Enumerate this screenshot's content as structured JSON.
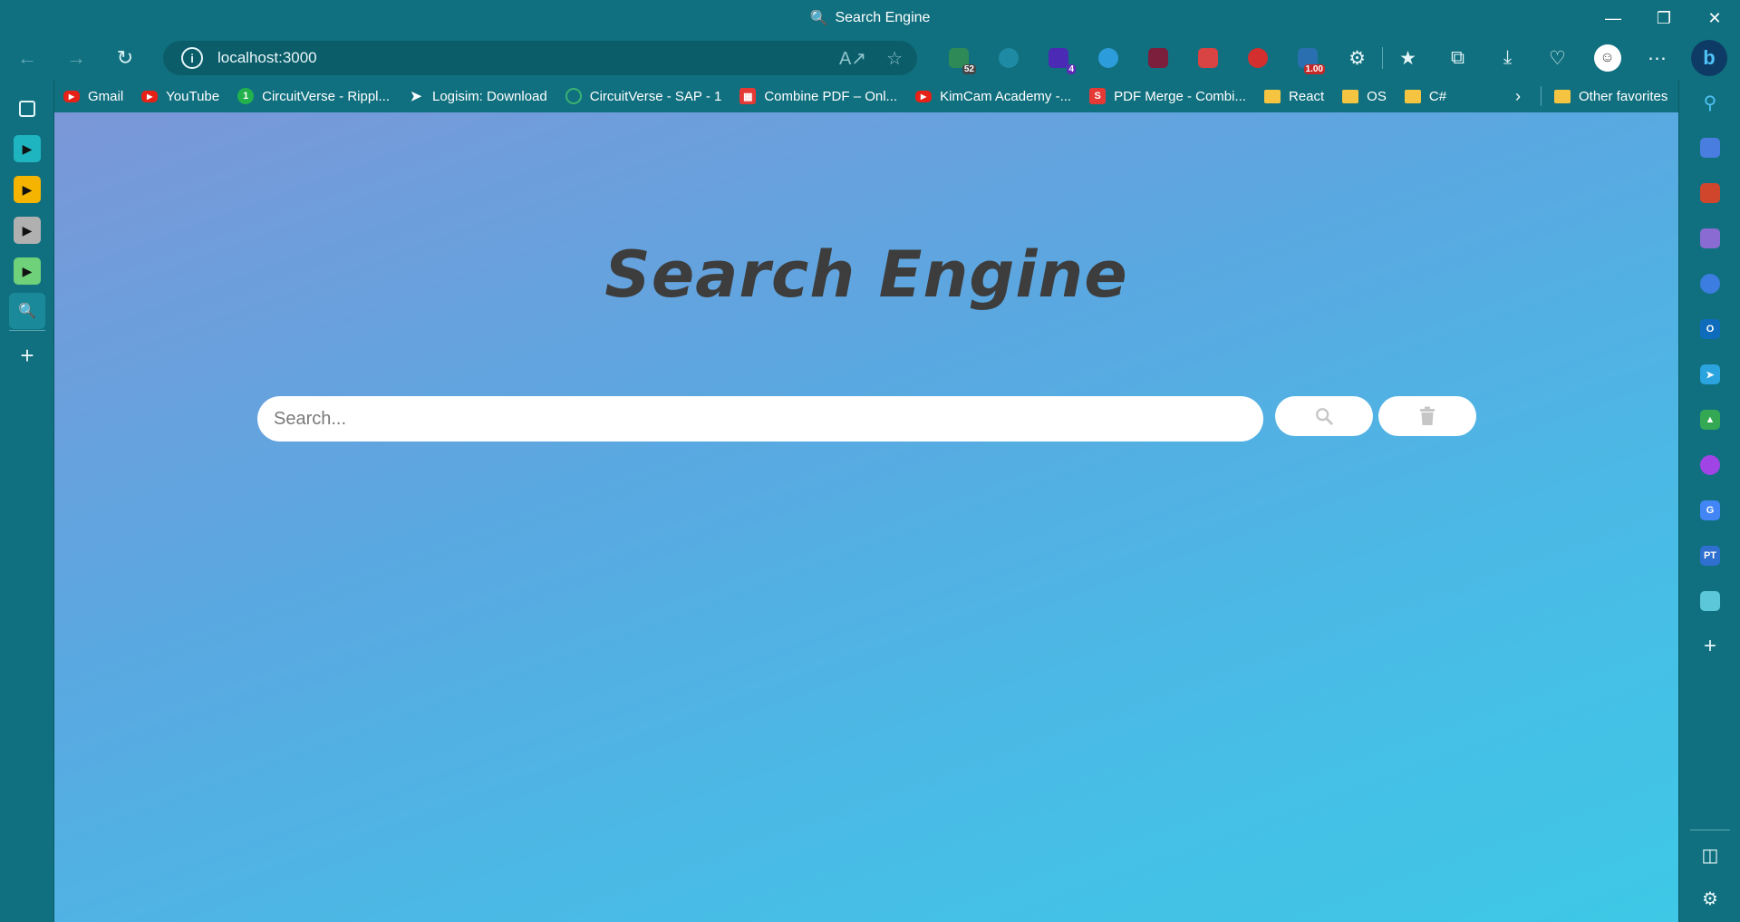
{
  "window": {
    "title": "Search Engine",
    "title_icon": "magnifier-icon"
  },
  "nav": {
    "url": "localhost:3000"
  },
  "extensions": [
    {
      "name": "extension-evernote",
      "color": "#2e8b57",
      "badge": "52"
    },
    {
      "name": "extension-swirl",
      "color": "#1f8aa3",
      "badge": ""
    },
    {
      "name": "extension-cube",
      "color": "#4b2bb5",
      "badge": "4"
    },
    {
      "name": "extension-edge-dev",
      "color": "#2d9cdb",
      "badge": ""
    },
    {
      "name": "extension-screen",
      "color": "#7b1f3d",
      "badge": ""
    },
    {
      "name": "extension-puzzle-red",
      "color": "#d84343",
      "badge": ""
    },
    {
      "name": "extension-vv",
      "color": "#d32f2f",
      "badge": ""
    },
    {
      "name": "extension-video-speed",
      "color": "#2a6fb0",
      "badge": "1.00"
    }
  ],
  "favorites": [
    {
      "label": "Gmail",
      "icon": "yt"
    },
    {
      "label": "YouTube",
      "icon": "yt"
    },
    {
      "label": "CircuitVerse - Rippl...",
      "icon": "cv"
    },
    {
      "label": "Logisim: Download",
      "icon": "logi"
    },
    {
      "label": "CircuitVerse - SAP - 1",
      "icon": "globe"
    },
    {
      "label": "Combine PDF – Onl...",
      "icon": "pdf"
    },
    {
      "label": "KimCam Academy -...",
      "icon": "yt"
    },
    {
      "label": "PDF Merge - Combi...",
      "icon": "s"
    },
    {
      "label": "React",
      "icon": "folder"
    },
    {
      "label": "OS",
      "icon": "folder"
    },
    {
      "label": "C#",
      "icon": "folder"
    }
  ],
  "favorites_other": "Other favorites",
  "left_tabs": [
    {
      "color": "#1fb5c0"
    },
    {
      "color": "#f5b400"
    },
    {
      "color": "#b0b0b0"
    },
    {
      "color": "#6fd17a"
    }
  ],
  "right_sidebar": [
    {
      "name": "search-icon"
    },
    {
      "name": "shopping-tag-icon"
    },
    {
      "name": "tools-icon"
    },
    {
      "name": "games-icon"
    },
    {
      "name": "copilot-icon"
    },
    {
      "name": "outlook-icon"
    },
    {
      "name": "telegram-icon"
    },
    {
      "name": "google-drive-icon"
    },
    {
      "name": "chatbot-icon"
    },
    {
      "name": "google-translate-icon"
    },
    {
      "name": "pt-icon"
    },
    {
      "name": "wordtune-icon"
    }
  ],
  "page": {
    "heading": "Search Engine",
    "search_placeholder": "Search..."
  }
}
